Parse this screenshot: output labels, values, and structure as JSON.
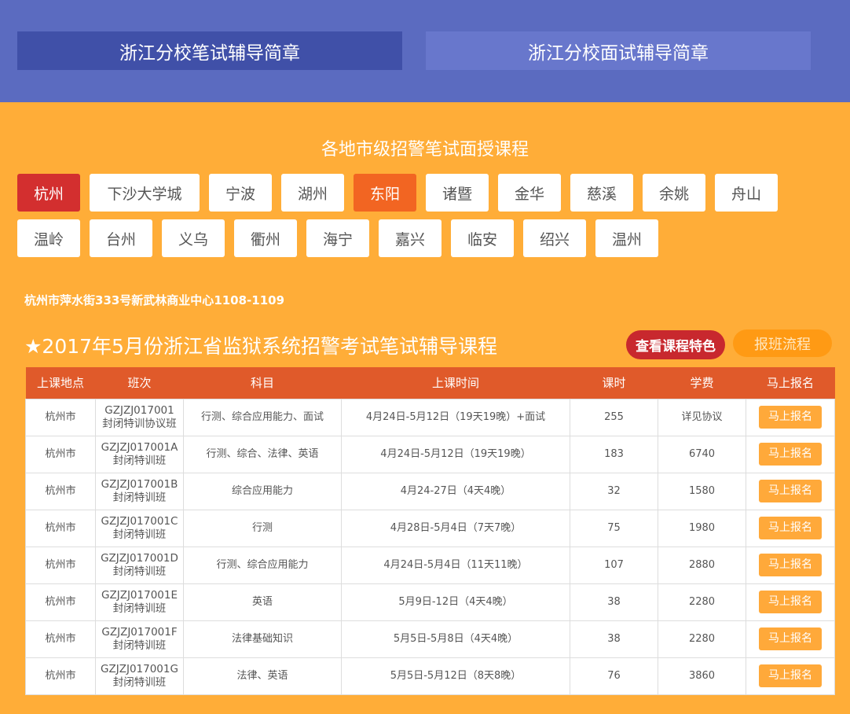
{
  "top_tabs": [
    {
      "label": "浙江分校笔试辅导简章",
      "active": true
    },
    {
      "label": "浙江分校面试辅导简章",
      "active": false
    }
  ],
  "section_title": "各地市级招警笔试面授课程",
  "cities": [
    {
      "label": "杭州",
      "state": "active-red"
    },
    {
      "label": "下沙大学城",
      "state": ""
    },
    {
      "label": "宁波",
      "state": ""
    },
    {
      "label": "湖州",
      "state": ""
    },
    {
      "label": "东阳",
      "state": "active-orange"
    },
    {
      "label": "诸暨",
      "state": ""
    },
    {
      "label": "金华",
      "state": ""
    },
    {
      "label": "慈溪",
      "state": ""
    },
    {
      "label": "余姚",
      "state": ""
    },
    {
      "label": "舟山",
      "state": ""
    },
    {
      "label": "温岭",
      "state": ""
    },
    {
      "label": "台州",
      "state": ""
    },
    {
      "label": "义乌",
      "state": ""
    },
    {
      "label": "衢州",
      "state": ""
    },
    {
      "label": "海宁",
      "state": ""
    },
    {
      "label": "嘉兴",
      "state": ""
    },
    {
      "label": "临安",
      "state": ""
    },
    {
      "label": "绍兴",
      "state": ""
    },
    {
      "label": "温州",
      "state": ""
    }
  ],
  "address": "杭州市萍水街333号新武林商业中心1108-1109",
  "course_title": "★2017年5月份浙江省监狱系统招警考试笔试辅导课程",
  "buttons": {
    "features": "查看课程特色",
    "process": "报班流程"
  },
  "colors": {
    "header_band": "#5B6BC0",
    "page_bg": "#FFAD38",
    "table_header": "#E05A2A",
    "active_city": "#D32F2F",
    "secondary_city": "#F26522",
    "signup_button": "#FFA93A"
  },
  "table": {
    "headers": [
      "上课地点",
      "班次",
      "科目",
      "上课时间",
      "课时",
      "学费",
      "马上报名"
    ],
    "rows": [
      {
        "location": "杭州市",
        "class": "GZJZJ017001 封闭特训协议班",
        "subjects": "行测、综合应用能力、面试",
        "time": "4月24日-5月12日（19天19晚）+面试",
        "hours": "255",
        "fee": "详见协议",
        "action": "马上报名"
      },
      {
        "location": "杭州市",
        "class": "GZJZJ017001A 封闭特训班",
        "subjects": "行测、综合、法律、英语",
        "time": "4月24日-5月12日（19天19晚）",
        "hours": "183",
        "fee": "6740",
        "action": "马上报名"
      },
      {
        "location": "杭州市",
        "class": "GZJZJ017001B 封闭特训班",
        "subjects": "综合应用能力",
        "time": "4月24-27日（4天4晚）",
        "hours": "32",
        "fee": "1580",
        "action": "马上报名"
      },
      {
        "location": "杭州市",
        "class": "GZJZJ017001C 封闭特训班",
        "subjects": "行测",
        "time": "4月28日-5月4日（7天7晚）",
        "hours": "75",
        "fee": "1980",
        "action": "马上报名"
      },
      {
        "location": "杭州市",
        "class": "GZJZJ017001D 封闭特训班",
        "subjects": "行测、综合应用能力",
        "time": "4月24日-5月4日（11天11晚）",
        "hours": "107",
        "fee": "2880",
        "action": "马上报名"
      },
      {
        "location": "杭州市",
        "class": "GZJZJ017001E 封闭特训班",
        "subjects": "英语",
        "time": "5月9日-12日（4天4晚）",
        "hours": "38",
        "fee": "2280",
        "action": "马上报名"
      },
      {
        "location": "杭州市",
        "class": "GZJZJ017001F 封闭特训班",
        "subjects": "法律基础知识",
        "time": "5月5日-5月8日（4天4晚）",
        "hours": "38",
        "fee": "2280",
        "action": "马上报名"
      },
      {
        "location": "杭州市",
        "class": "GZJZJ017001G 封闭特训班",
        "subjects": "法律、英语",
        "time": "5月5日-5月12日（8天8晚）",
        "hours": "76",
        "fee": "3860",
        "action": "马上报名"
      }
    ]
  }
}
